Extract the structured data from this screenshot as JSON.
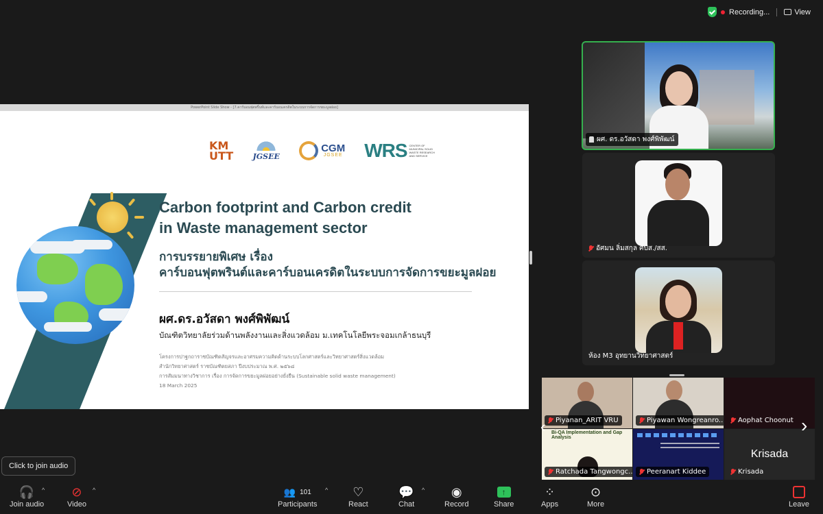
{
  "status": {
    "recording_label": "Recording...",
    "view_label": "View"
  },
  "slide": {
    "window_title": "PowerPoint Slide Show - [7.คาร์บอนฟุตพริ้นท์และคาร์บอนเครดิตในระบบการจัดการขยะมูลฝอย]",
    "logos": {
      "kmutt": "KM\nUTT",
      "jgsee": "JGSEE",
      "cgm": "CGM",
      "cgm_sub": "JGSEE",
      "wrs": "WRS",
      "wrs_sub": "CENTER OF MUNICIPAL SOLID WASTE RESEARCH AND SERVICE"
    },
    "title_en_1": "Carbon footprint and Carbon credit",
    "title_en_2": "in Waste management sector",
    "title_th_1": "การบรรยายพิเศษ เรื่อง",
    "title_th_2": "คาร์บอนฟุตพรินต์และคาร์บอนเครดิตในระบบการจัดการขยะมูลฝอย",
    "speaker": "ผศ.ดร.อวัสดา พงศ์พิพัฒน์",
    "affiliation": "บัณฑิตวิทยาลัยร่วมด้านพลังงานและสิ่งแวดล้อม ม.เทคโนโลยีพระจอมเกล้าธนบุรี",
    "small_1": "โครงการปาฐกถาราชบัณฑิตสัญจรและอาศรมความคิดด้านระบบโลกศาสตร์และวิทยาศาสตร์สิ่งแวดล้อม",
    "small_2": "สำนักวิทยาศาสตร์ ราชบัณฑิตยสภา ปีงบประมาณ พ.ศ. ๒๕๖๘",
    "small_3": "การสัมมนาทางวิชาการ เรื่อง การจัดการขยะมูลฝอยอย่างยั่งยืน (Sustainable solid waste management)",
    "small_4": "18 March 2025"
  },
  "speakers": [
    {
      "name": "ผศ. ดร.อวัสดา  พงศ์พิพัฒน์"
    },
    {
      "name": "อัศมน ลิ่มสกุล ศปส./สส."
    },
    {
      "name": "ห้อง M3 อุทยานวิทยาศาสตร์"
    }
  ],
  "gallery": [
    {
      "name": "Piyanan_ARIT VRU"
    },
    {
      "name": "Piyawan Wongreanro..."
    },
    {
      "name": "Aophat Choonut"
    },
    {
      "name": "Ratchada Tangwongc..."
    },
    {
      "name": "Peeranart Kiddee"
    },
    {
      "name": "Krisada",
      "big_label": "Krisada"
    }
  ],
  "tooltip": "Click to join audio",
  "toolbar": {
    "join_audio": "Join audio",
    "video": "Video",
    "participants": "Participants",
    "participants_count": "101",
    "react": "React",
    "chat": "Chat",
    "record": "Record",
    "share": "Share",
    "apps": "Apps",
    "more": "More",
    "leave": "Leave"
  }
}
